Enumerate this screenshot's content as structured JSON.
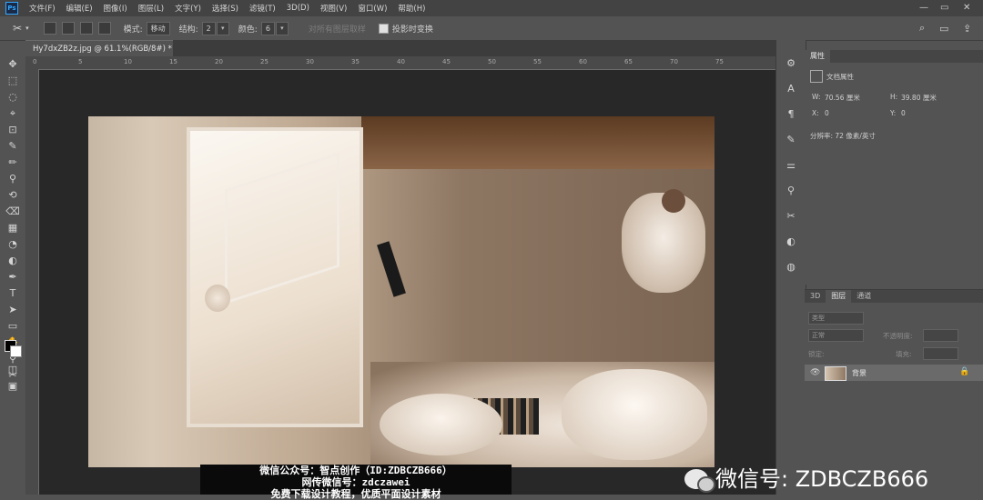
{
  "menu": [
    "文件(F)",
    "编辑(E)",
    "图像(I)",
    "图层(L)",
    "文字(Y)",
    "选择(S)",
    "滤镜(T)",
    "3D(D)",
    "视图(V)",
    "窗口(W)",
    "帮助(H)"
  ],
  "app_logo": "Ps",
  "window_controls": [
    "—",
    "▭",
    "✕"
  ],
  "options": {
    "mode_label": "模式:",
    "mode_value": "移动",
    "structure_label": "结构:",
    "structure_value": "2",
    "color_label": "颜色:",
    "color_value": "6",
    "sample_all": "对所有图层取样",
    "transform_label": "投影时变换",
    "transform_checked": true
  },
  "document_tab": {
    "title": "Hy7dxZB2z.jpg @ 61.1%(RGB/8#) *",
    "close": "×"
  },
  "ruler_top_ticks": [
    "0",
    "5",
    "10",
    "15",
    "20",
    "25",
    "30",
    "35",
    "40",
    "45",
    "50",
    "55",
    "60",
    "65",
    "70",
    "75"
  ],
  "tools": [
    "move-icon",
    "marquee-icon",
    "lasso-icon",
    "quick-select-icon",
    "crop-icon",
    "eyedropper-icon",
    "brush-icon",
    "stamp-icon",
    "history-brush-icon",
    "eraser-icon",
    "gradient-icon",
    "blur-icon",
    "dodge-icon",
    "pen-icon",
    "type-icon",
    "path-select-icon",
    "shape-icon",
    "hand-icon",
    "zoom-icon",
    "content-aware-move-icon"
  ],
  "tool_glyphs": [
    "✥",
    "⬚",
    "◌",
    "⌖",
    "⊡",
    "✎",
    "✏",
    "⚲",
    "⟲",
    "⌫",
    "▦",
    "◔",
    "◐",
    "✒",
    "T",
    "➤",
    "▭",
    "✋",
    "⚲",
    "✂"
  ],
  "properties": {
    "tab": "属性",
    "section": "文档属性",
    "w_label": "W:",
    "w_value": "70.56 厘米",
    "h_label": "H:",
    "h_value": "39.80 厘米",
    "x_label": "X:",
    "x_value": "0",
    "y_label": "Y:",
    "y_value": "0",
    "resolution": "分辨率: 72 像素/英寸"
  },
  "layers_panel": {
    "tabs": [
      "3D",
      "图层",
      "通道"
    ],
    "active_tab": "图层",
    "filter_placeholder": "类型",
    "blend_mode": "正常",
    "opacity_label": "不透明度:",
    "lock_label": "锁定:",
    "fill_label": "填充:",
    "layer_name": "背景"
  },
  "watermark": {
    "line1": "微信公众号：智点创作（ID:ZDBCZB666）",
    "line2": "网传微信号：zdczawei",
    "line3": "免费下载设计教程，优质平面设计素材"
  },
  "wechat_text": "微信号: ZDBCZB666",
  "colors": {
    "accent": "#31a8ff",
    "panel_bg": "#535353",
    "workspace": "#282828"
  }
}
